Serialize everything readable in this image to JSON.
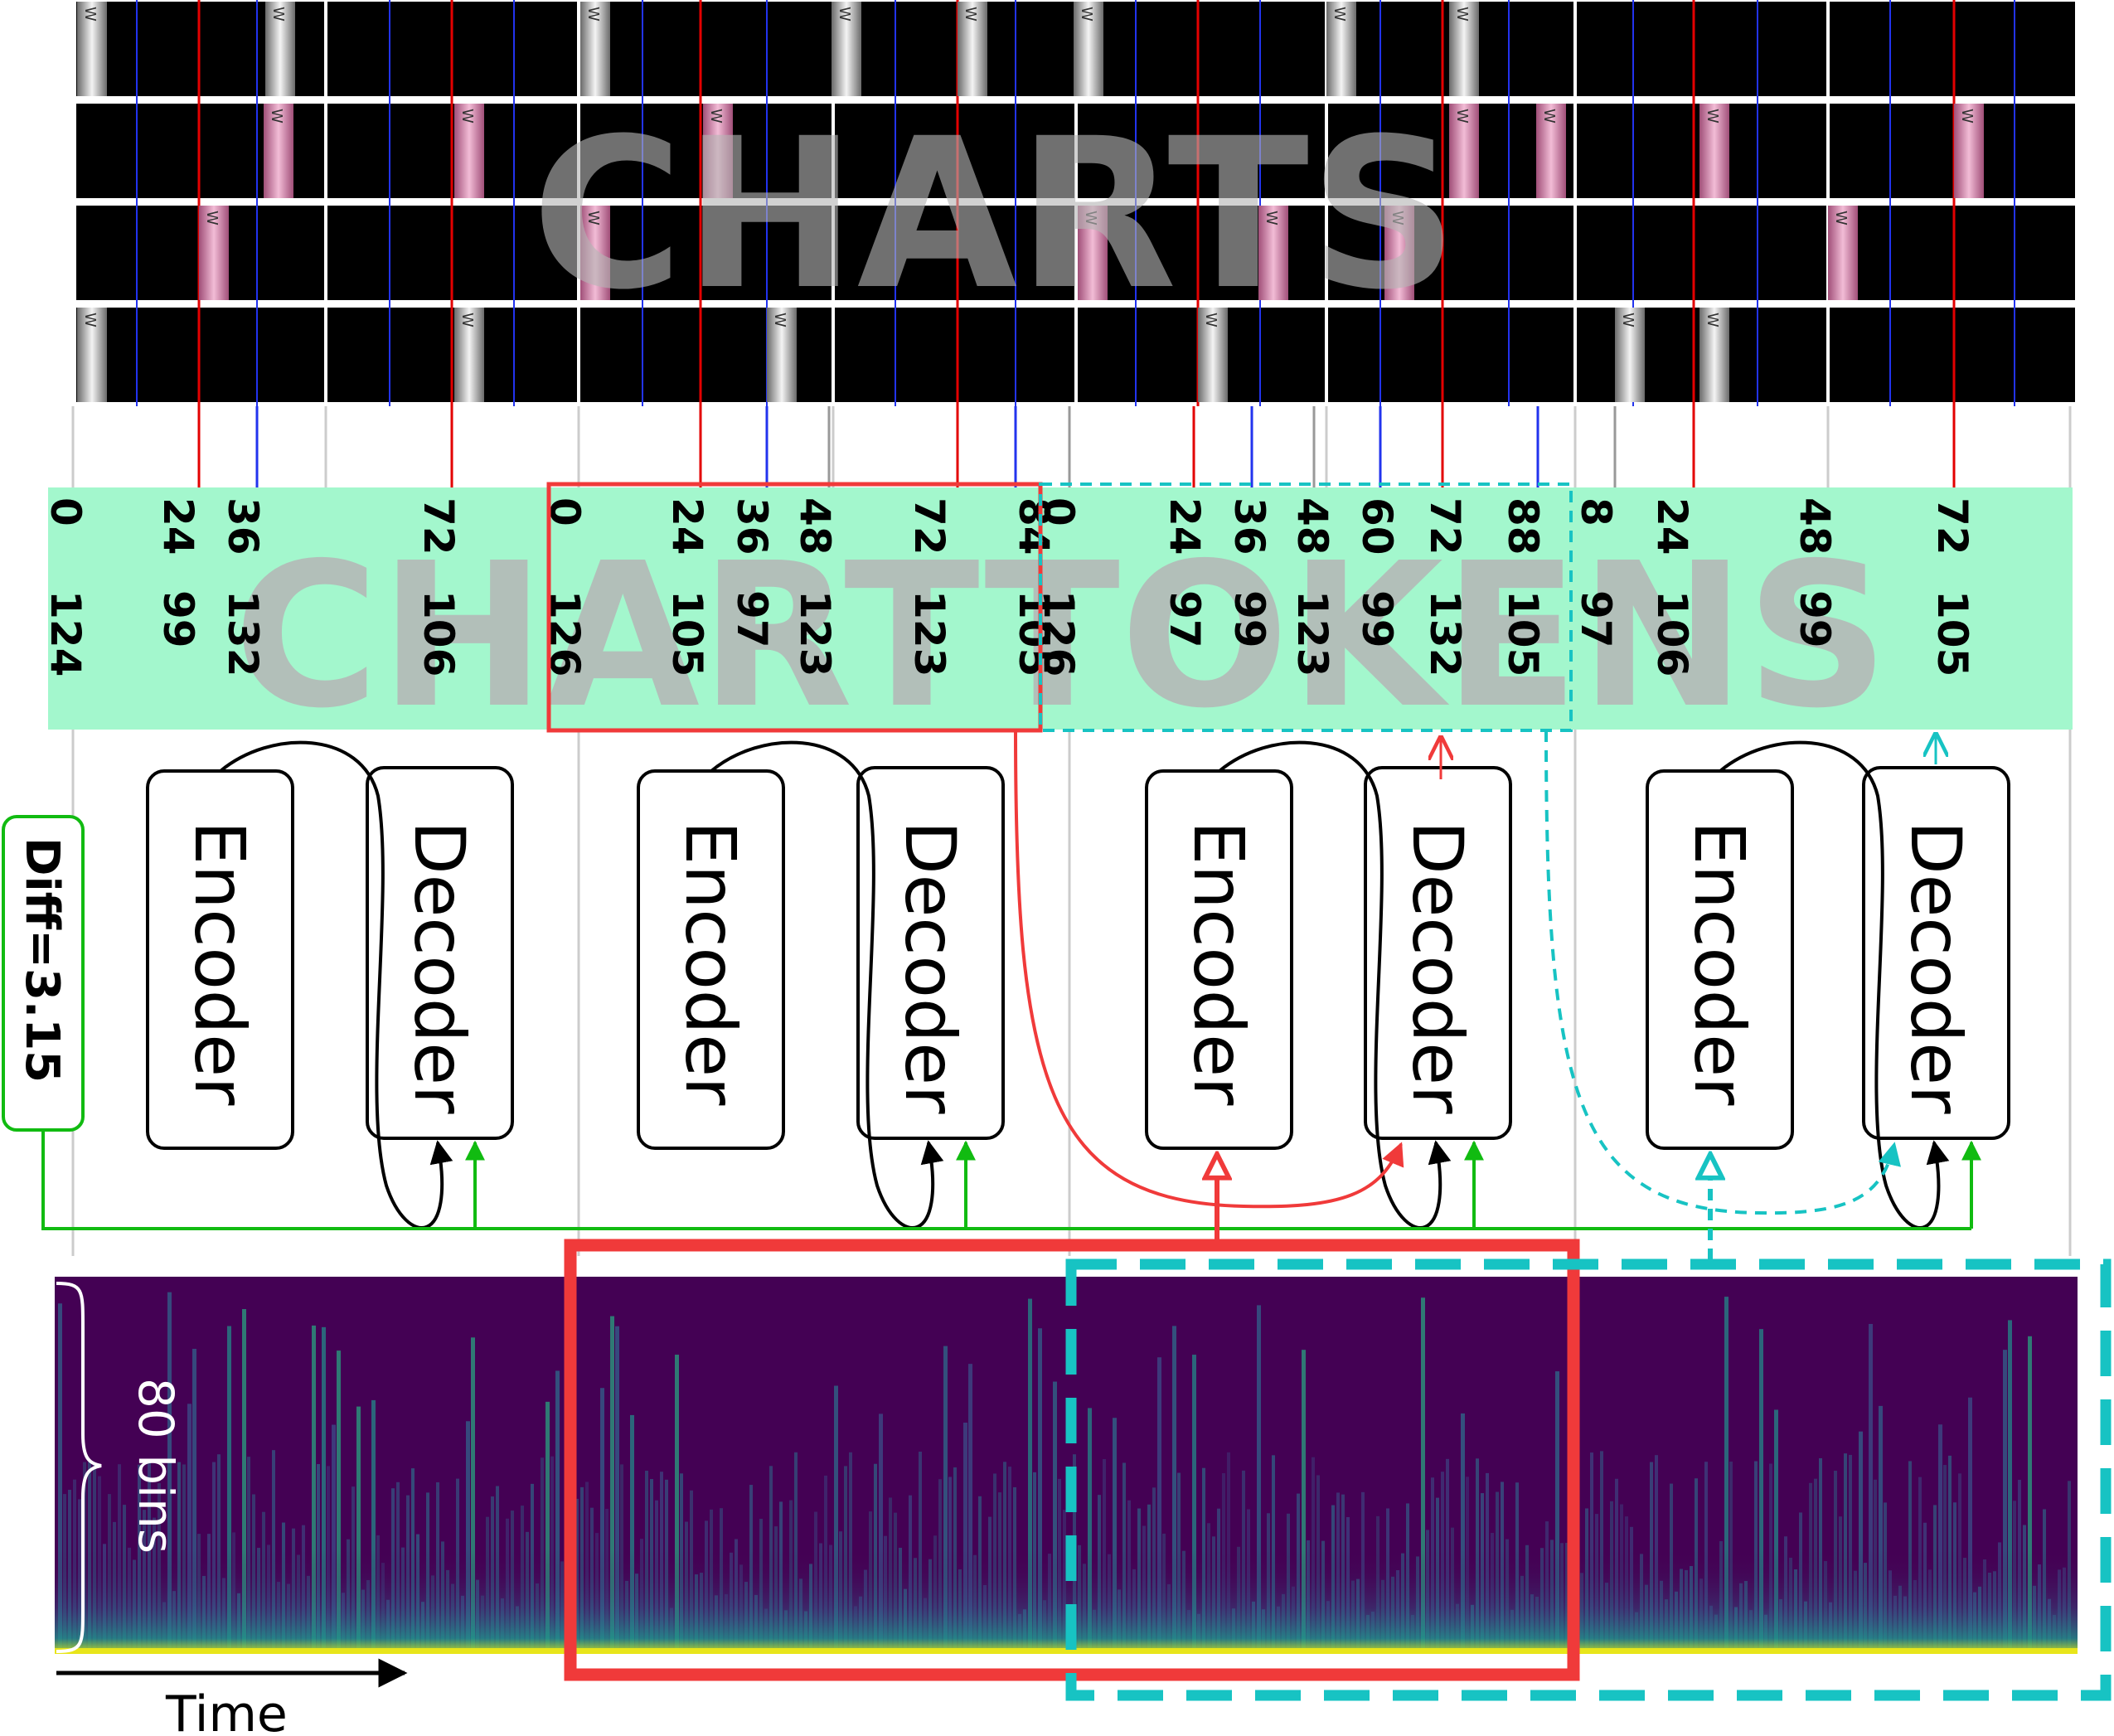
{
  "watermarks": {
    "top": "CHARTS",
    "middle": "CHARTTOKENS"
  },
  "note_glyph": "W",
  "difficulty_label": "Diff=3.15",
  "encoder_label": "Encoder",
  "decoder_label": "Decoder",
  "bins_label": "80 bins",
  "time_label": "Time",
  "colors": {
    "tokens_bg": "#a3f7cd",
    "red_window": "#f03a3a",
    "cyan_window": "#17c3c3",
    "green_path": "#11bb11",
    "red_beat": "#e30000",
    "blue_beat": "#2233ee",
    "grey_beat": "#999999",
    "spectrogram_bg": "#440154"
  },
  "token_columns": [
    {
      "time": "0",
      "value": "124"
    },
    {
      "time": "24",
      "value": "99"
    },
    {
      "time": "36",
      "value": "132"
    },
    {
      "time": "72",
      "value": "106"
    },
    {
      "time": "0",
      "value": "126"
    },
    {
      "time": "24",
      "value": "105"
    },
    {
      "time": "36",
      "value": "97"
    },
    {
      "time": "48",
      "value": "123"
    },
    {
      "time": "72",
      "value": "123"
    },
    {
      "time": "84",
      "value": "105"
    },
    {
      "time": "0",
      "value": "126"
    },
    {
      "time": "24",
      "value": "97"
    },
    {
      "time": "36",
      "value": "99"
    },
    {
      "time": "48",
      "value": "123"
    },
    {
      "time": "60",
      "value": "99"
    },
    {
      "time": "72",
      "value": "132"
    },
    {
      "time": "88",
      "value": "105"
    },
    {
      "time": "8",
      "value": "97"
    },
    {
      "time": "24",
      "value": "106"
    },
    {
      "time": "48",
      "value": "99"
    },
    {
      "time": "72",
      "value": "105"
    }
  ]
}
